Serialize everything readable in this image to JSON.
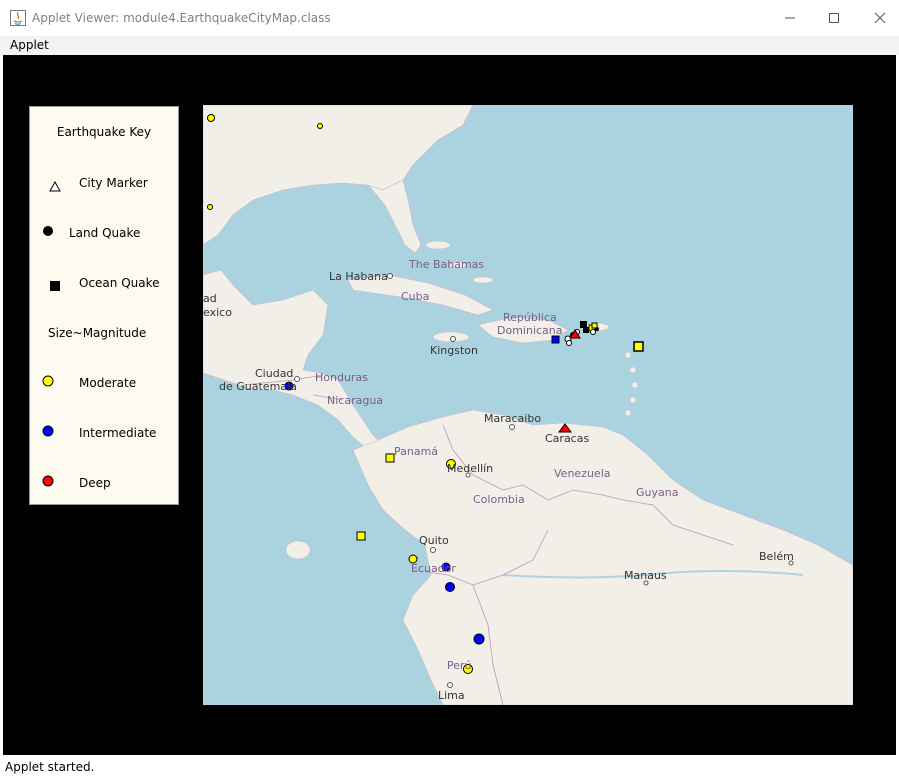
{
  "window": {
    "title": "Applet Viewer: module4.EarthquakeCityMap.class"
  },
  "menu": {
    "items": [
      "Applet"
    ]
  },
  "key": {
    "title": "Earthquake Key",
    "city_marker": "City Marker",
    "land_quake": "Land Quake",
    "ocean_quake": "Ocean Quake",
    "size_magnitude": "Size~Magnitude",
    "moderate": "Moderate",
    "intermediate": "Intermediate",
    "deep": "Deep",
    "colors": {
      "moderate": "#ffff00",
      "intermediate": "#0000ff",
      "deep": "#ff0000"
    }
  },
  "map": {
    "labels": {
      "la_habana": "La Habana",
      "the_bahamas": "The Bahamas",
      "cuba": "Cuba",
      "republica": "República",
      "dominicana": "Dominicana",
      "kingston": "Kingston",
      "ciudad": "Ciudad",
      "de_guatemala": "de Guatemala",
      "honduras": "Honduras",
      "nicaragua": "Nicaragua",
      "maracaibo": "Maracaibo",
      "caracas": "Caracas",
      "panama": "Panamá",
      "medellin": "Medellín",
      "venezuela": "Venezuela",
      "colombia": "Colombia",
      "guyana": "Guyana",
      "quito": "Quito",
      "ecuador": "Ecuador",
      "manaus": "Manaus",
      "belem": "Belém",
      "peru": "Perú",
      "lima": "Lima",
      "cut_ad": "ad",
      "cut_exico": "exico"
    }
  },
  "status": {
    "text": "Applet started."
  }
}
